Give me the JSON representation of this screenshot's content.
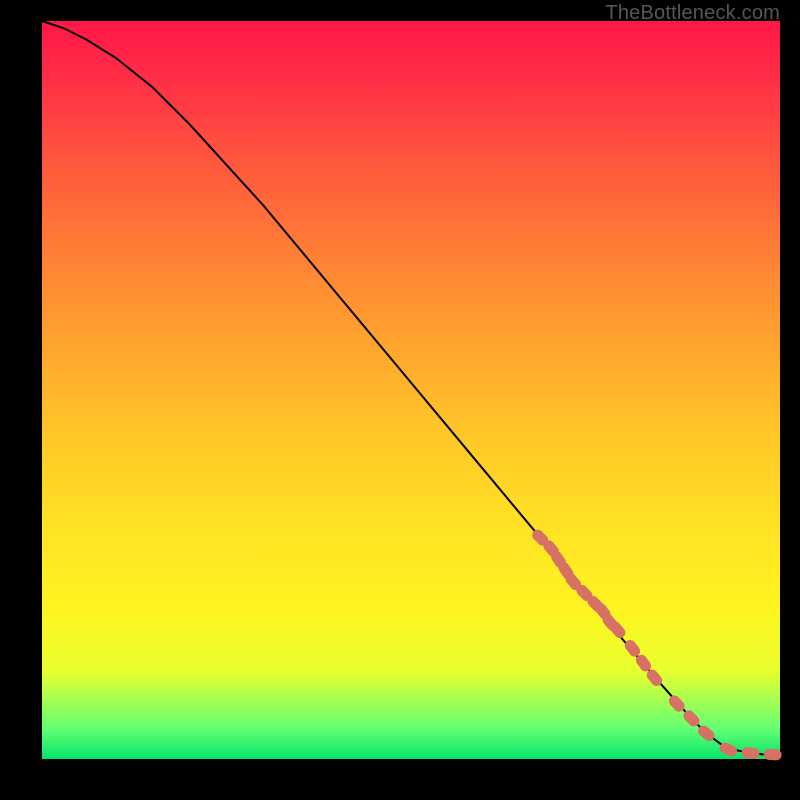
{
  "watermark": "TheBottleneck.com",
  "colors": {
    "curve_stroke": "#000000",
    "marker_fill": "#d77164",
    "plot_bg_top": "#ff1648",
    "plot_bg_bottom": "#06e36a",
    "frame": "#000000"
  },
  "chart_data": {
    "type": "line",
    "title": "",
    "xlabel": "",
    "ylabel": "",
    "xlim": [
      0,
      100
    ],
    "ylim": [
      0,
      100
    ],
    "series": [
      {
        "name": "curve",
        "x": [
          0,
          3,
          6,
          10,
          15,
          20,
          30,
          40,
          50,
          60,
          70,
          78,
          84,
          88,
          90,
          92,
          94,
          96,
          98,
          100
        ],
        "y": [
          100,
          99,
          97.5,
          95,
          91,
          86,
          75,
          63,
          51,
          39,
          27,
          17,
          10,
          5.5,
          3.5,
          2,
          1.2,
          0.8,
          0.6,
          0.6
        ]
      },
      {
        "name": "markers",
        "x": [
          67.5,
          69,
          70,
          71,
          72,
          73.5,
          75,
          76,
          77,
          78,
          80,
          81.5,
          83,
          86,
          88,
          90,
          93,
          96,
          99
        ],
        "y": [
          30,
          28.5,
          27,
          25.5,
          24,
          22.5,
          21,
          20,
          18.5,
          17.5,
          15,
          13,
          11,
          7.5,
          5.5,
          3.5,
          1.3,
          0.8,
          0.6
        ]
      }
    ]
  }
}
